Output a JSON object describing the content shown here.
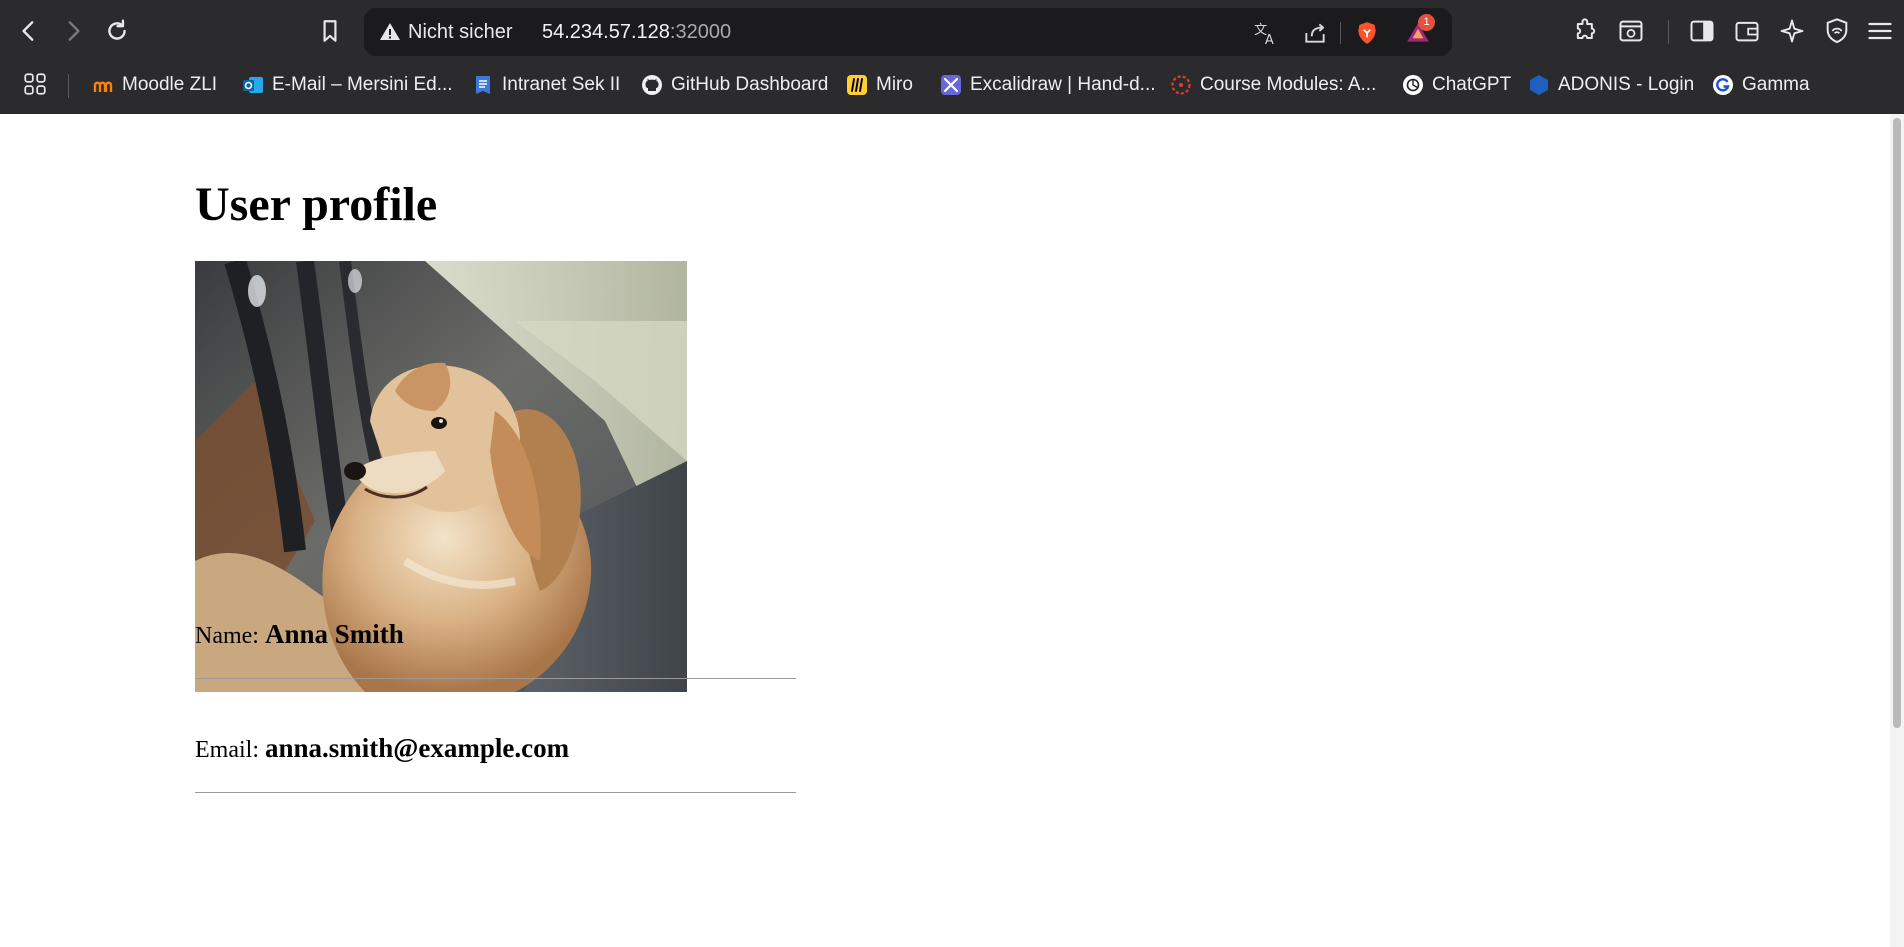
{
  "browser": {
    "security_label": "Nicht sicher",
    "url_host": "54.234.57.128",
    "url_port": ":32000",
    "notification_count": "1",
    "bookmarks": [
      {
        "label": "Moodle ZLI",
        "icon": "moodle-icon"
      },
      {
        "label": "E-Mail – Mersini Ed...",
        "icon": "outlook-icon"
      },
      {
        "label": "Intranet Sek II",
        "icon": "intranet-icon"
      },
      {
        "label": "GitHub Dashboard",
        "icon": "github-icon"
      },
      {
        "label": "Miro",
        "icon": "miro-icon"
      },
      {
        "label": "Excalidraw | Hand-d...",
        "icon": "excalidraw-icon"
      },
      {
        "label": "Course Modules: A...",
        "icon": "canvas-icon"
      },
      {
        "label": "ChatGPT",
        "icon": "chatgpt-icon"
      },
      {
        "label": "ADONIS - Login",
        "icon": "adonis-icon"
      },
      {
        "label": "Gamma",
        "icon": "gamma-icon"
      }
    ]
  },
  "page": {
    "title": "User profile",
    "photo_subject": "dog",
    "name_label": "Name:",
    "name_value": "Anna Smith",
    "email_label": "Email:",
    "email_value": "anna.smith@example.com"
  },
  "colors": {
    "chrome": "#2b2b2d",
    "urlbar": "#1b1b1d",
    "brave_orange": "#fb542b",
    "badge_red": "#e8503c"
  }
}
